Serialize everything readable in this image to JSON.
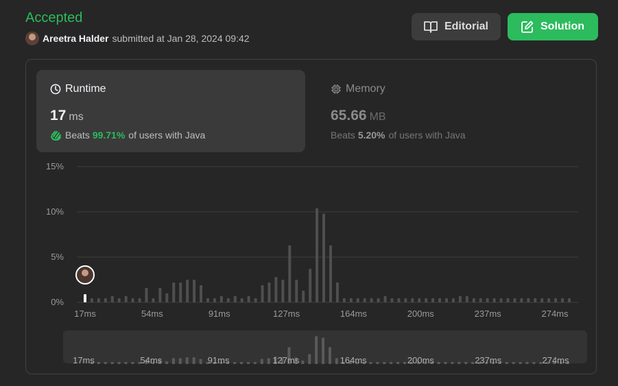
{
  "submission": {
    "status": "Accepted",
    "user": "Areetra Halder",
    "submitted_text": "submitted at Jan 28, 2024 09:42"
  },
  "buttons": {
    "editorial": "Editorial",
    "solution": "Solution"
  },
  "runtime": {
    "title": "Runtime",
    "value": "17",
    "unit": "ms",
    "beats_label": "Beats",
    "beats_pct": "99.71%",
    "beats_suffix": "of users with Java"
  },
  "memory": {
    "title": "Memory",
    "value": "65.66",
    "unit": "MB",
    "beats_label": "Beats",
    "beats_pct": "5.20%",
    "beats_suffix": "of users with Java"
  },
  "colors": {
    "accent": "#2cbb5d",
    "bar": "#4f4f4f",
    "bar_highlight": "#ffffff"
  },
  "chart_data": {
    "type": "bar",
    "ylabel_ticks": [
      "15%",
      "10%",
      "5%",
      "0%"
    ],
    "ylim": [
      0,
      15
    ],
    "xticks": [
      "17ms",
      "54ms",
      "91ms",
      "127ms",
      "164ms",
      "200ms",
      "237ms",
      "274ms"
    ],
    "highlight_index": 0,
    "values": [
      0.9,
      0.45,
      0.45,
      0.45,
      0.7,
      0.45,
      0.7,
      0.45,
      0.45,
      1.6,
      0.45,
      1.6,
      1.0,
      2.2,
      2.2,
      2.5,
      2.5,
      1.9,
      0.45,
      0.45,
      0.7,
      0.45,
      0.7,
      0.45,
      0.7,
      0.45,
      1.9,
      2.2,
      2.8,
      2.5,
      6.3,
      2.5,
      1.3,
      3.7,
      10.4,
      9.8,
      6.3,
      2.2,
      0.45,
      0.45,
      0.45,
      0.45,
      0.45,
      0.45,
      0.7,
      0.45,
      0.45,
      0.45,
      0.45,
      0.45,
      0.45,
      0.45,
      0.45,
      0.45,
      0.45,
      0.7,
      0.7,
      0.45,
      0.45,
      0.45,
      0.45,
      0.45,
      0.45,
      0.45,
      0.45,
      0.45,
      0.45,
      0.45,
      0.45,
      0.45,
      0.45,
      0.45
    ]
  }
}
